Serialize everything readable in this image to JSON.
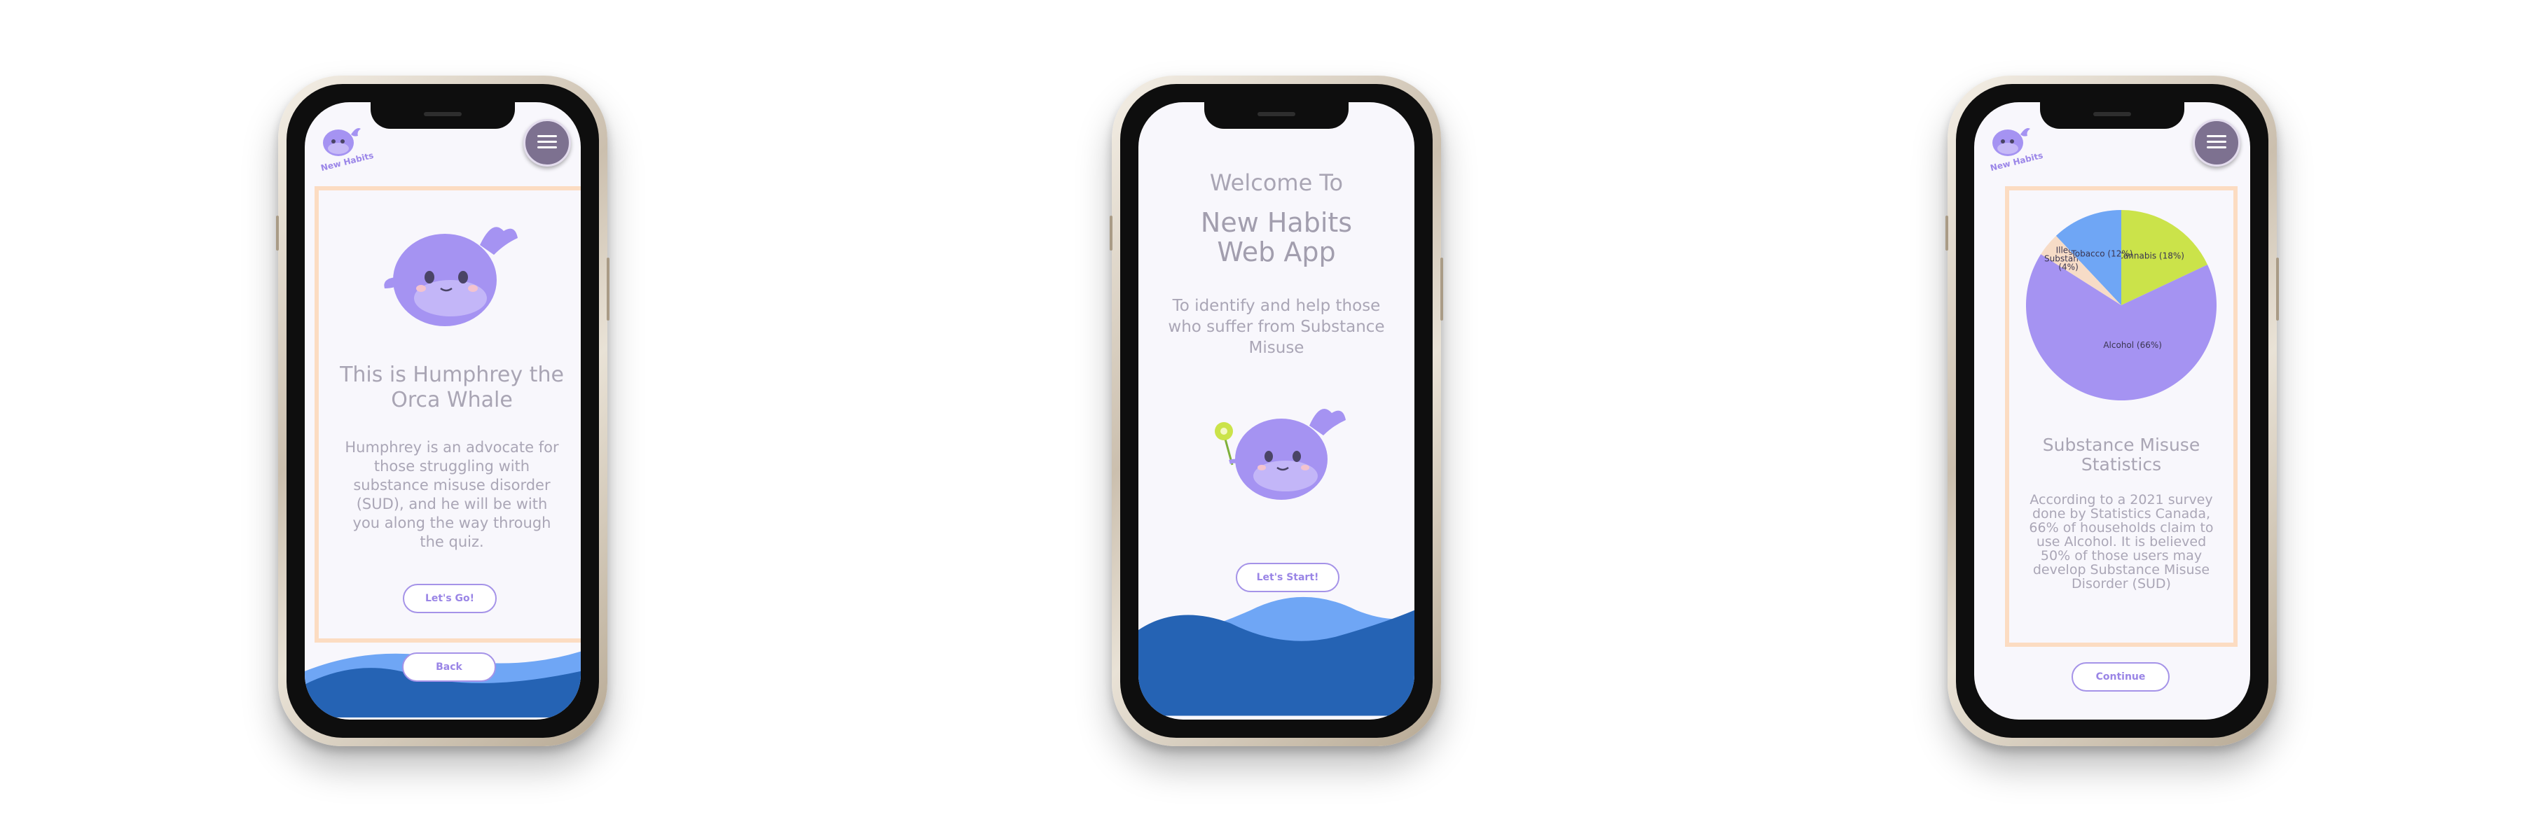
{
  "colors": {
    "accent_purple": "#a593e8",
    "card_border": "#fcdcc2",
    "wave_dark": "#2563b4",
    "wave_light": "#6fa6f5",
    "heading_gray": "#a9a5b4"
  },
  "logo": {
    "text": "New Habits"
  },
  "screen1": {
    "title": "This is Humphrey the Orca Whale",
    "description": "Humphrey is an advocate for those struggling with substance misuse disorder (SUD), and he will be with you along the way through the quiz.",
    "primary_button": "Let's Go!",
    "back_button": "Back"
  },
  "screen2": {
    "welcome": "Welcome To",
    "app_name_line1": "New Habits",
    "app_name_line2": "Web App",
    "tagline": "To identify and help those who suffer from Substance Misuse",
    "start_button": "Let's Start!"
  },
  "screen3": {
    "title": "Substance Misuse Statistics",
    "description": "According to a 2021 survey done by Statistics Canada, 66% of households claim to use Alcohol. It is believed 50% of those users may develop Substance Misuse Disorder (SUD)",
    "continue_button": "Continue"
  },
  "chart_data": {
    "type": "pie",
    "slices": [
      {
        "label": "Cannabis (18%)",
        "value": 18,
        "color": "#cbe34a"
      },
      {
        "label": "Alcohol (66%)",
        "value": 66,
        "color": "#a593f2"
      },
      {
        "label": "Illegal Substances (4%)",
        "value": 4,
        "color": "#f7dcc7"
      },
      {
        "label": "Tobacco (12%)",
        "value": 12,
        "color": "#6fa6f5"
      }
    ]
  }
}
